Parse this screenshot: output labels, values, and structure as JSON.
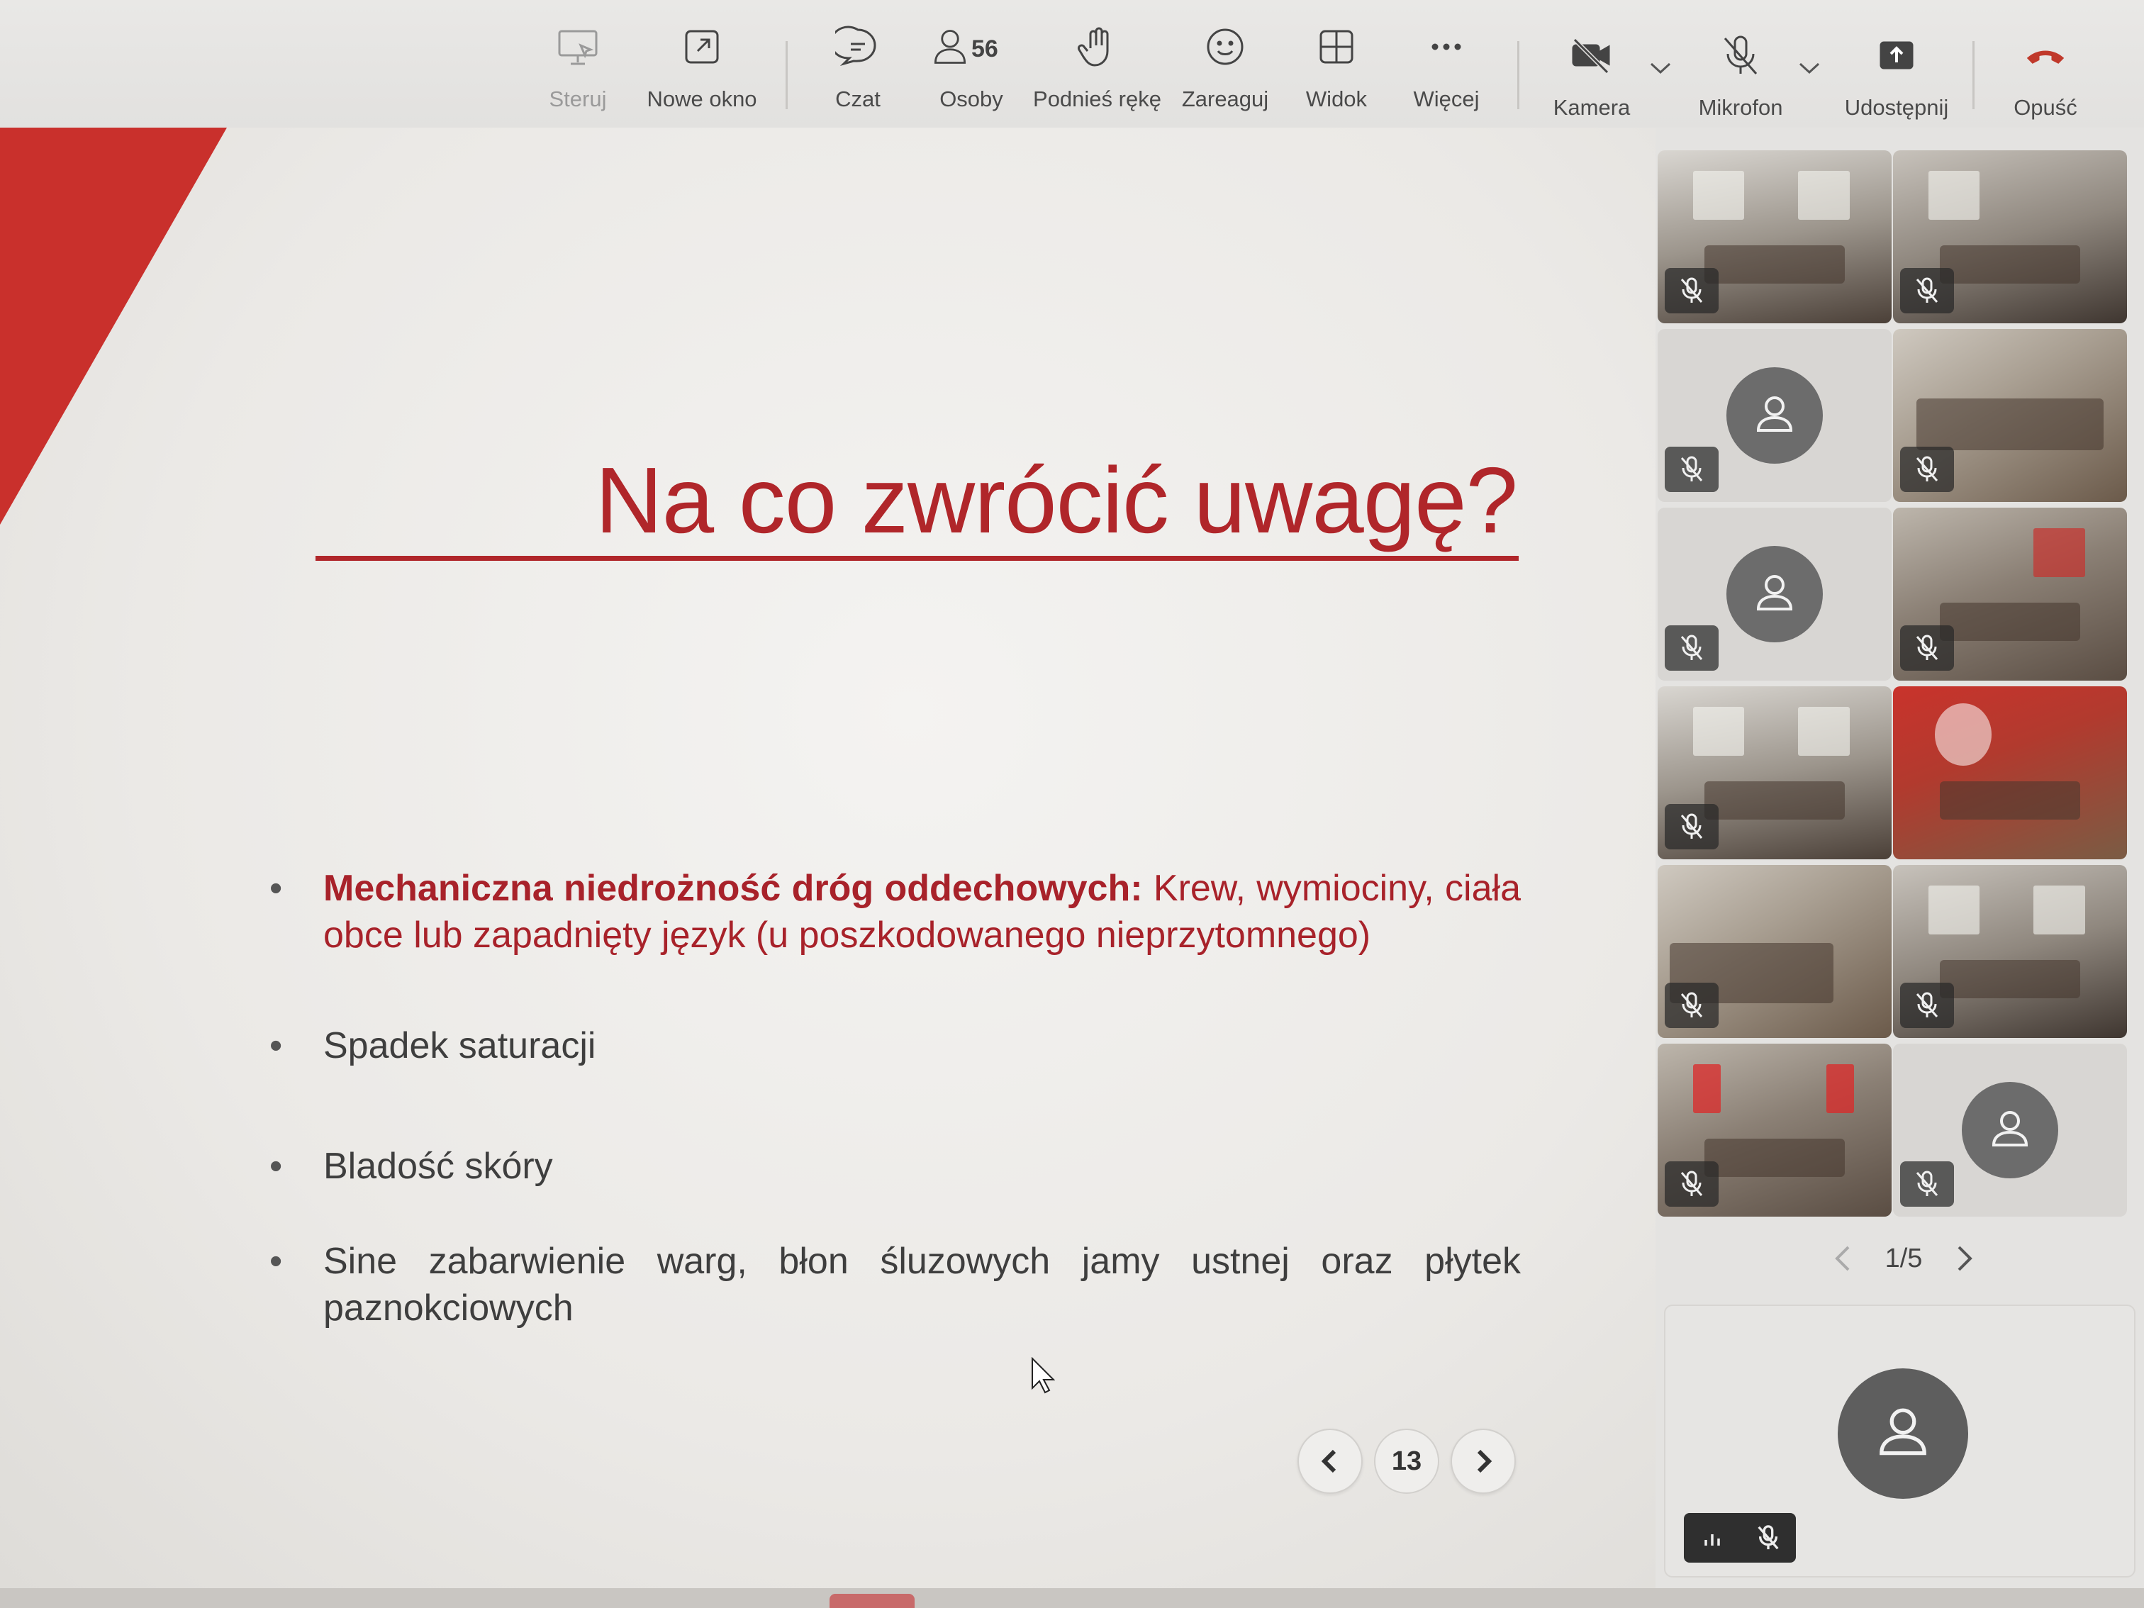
{
  "toolbar": {
    "control": "Steruj",
    "new_window": "Nowe okno",
    "chat": "Czat",
    "people": "Osoby",
    "people_count": "56",
    "raise_hand": "Podnieś rękę",
    "react": "Zareaguj",
    "view": "Widok",
    "more": "Więcej",
    "camera": "Kamera",
    "microphone": "Mikrofon",
    "share": "Udostępnij",
    "leave": "Opuść"
  },
  "slide": {
    "title": "Na co zwrócić uwagę?",
    "bullets": [
      {
        "bold": "Mechaniczna niedrożność dróg oddechowych:",
        "text": " Krew, wymiociny, ciała obce lub zapadnięty język (u poszkodowanego nieprzytomnego)"
      },
      {
        "text": "Spadek saturacji"
      },
      {
        "text": "Bladość skóry"
      },
      {
        "text": "Sine zabarwienie warg, błon śluzowych jamy ustnej oraz płytek paznokciowych"
      }
    ],
    "page_number": "13"
  },
  "gallery": {
    "pager": "1/5"
  },
  "colors": {
    "accent_red": "#b0262a",
    "leave_red": "#c0392b"
  }
}
